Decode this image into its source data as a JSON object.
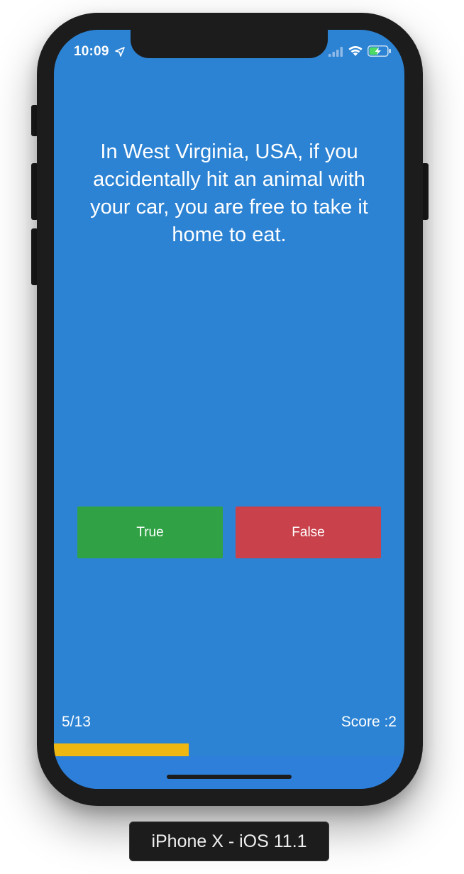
{
  "status_bar": {
    "time": "10:09",
    "icons": [
      "location-arrow-icon",
      "cellular-signal-icon",
      "wifi-icon",
      "battery-charging-icon"
    ]
  },
  "quiz": {
    "question": "In West Virginia, USA, if you accidentally hit an animal with your car, you are free to take it home to eat.",
    "true_label": "True",
    "false_label": "False",
    "progress_text": "5/13",
    "score_text": "Score :2",
    "progress_fraction": 0.385
  },
  "device": {
    "caption": "iPhone X - iOS 11.1"
  },
  "colors": {
    "background": "#2c83d3",
    "true_button": "#30a245",
    "false_button": "#c9414b",
    "progress_bar": "#efb711",
    "device_frame": "#1c1c1c"
  }
}
